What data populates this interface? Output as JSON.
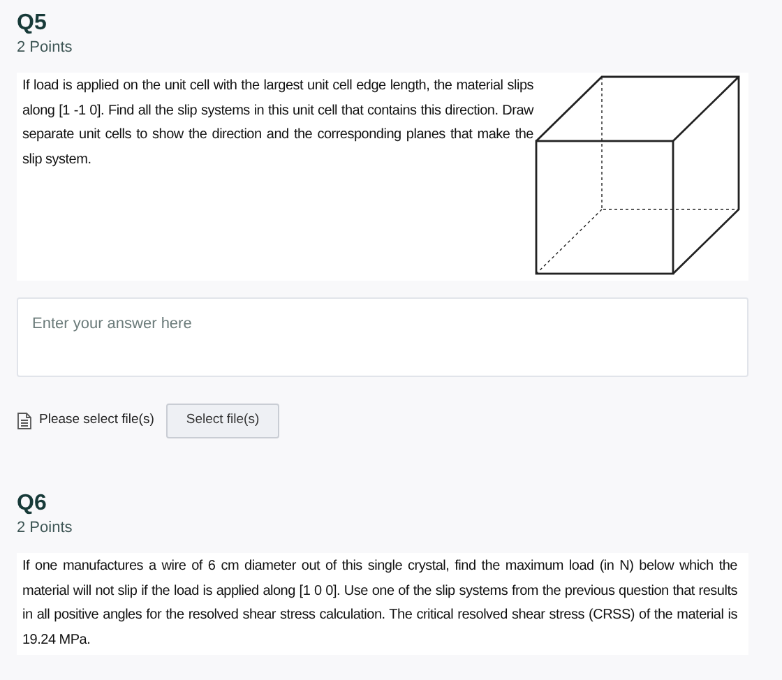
{
  "questions": [
    {
      "number": "Q5",
      "points": "2 Points",
      "prompt": "If load is applied on the unit cell with the largest unit cell edge length, the material slips along [1 -1 0]. Find all the slip systems in this unit cell that contains this direction. Draw separate unit cells to show the direction and the corresponding planes that make the slip system.",
      "figure": {
        "kind": "cube"
      },
      "answer": {
        "placeholder": "Enter your answer here"
      },
      "upload": {
        "label": "Please select file(s)",
        "button": "Select file(s)"
      }
    },
    {
      "number": "Q6",
      "points": "2 Points",
      "prompt": "If one manufactures a wire of 6 cm diameter out of this single crystal, find the maximum load (in N) below which the material will not slip if the load is applied along [1 0 0]. Use one of the slip systems from the previous question that results in all positive angles for the resolved shear stress calculation. The critical resolved shear stress (CRSS) of the material is 19.24 MPa."
    }
  ]
}
